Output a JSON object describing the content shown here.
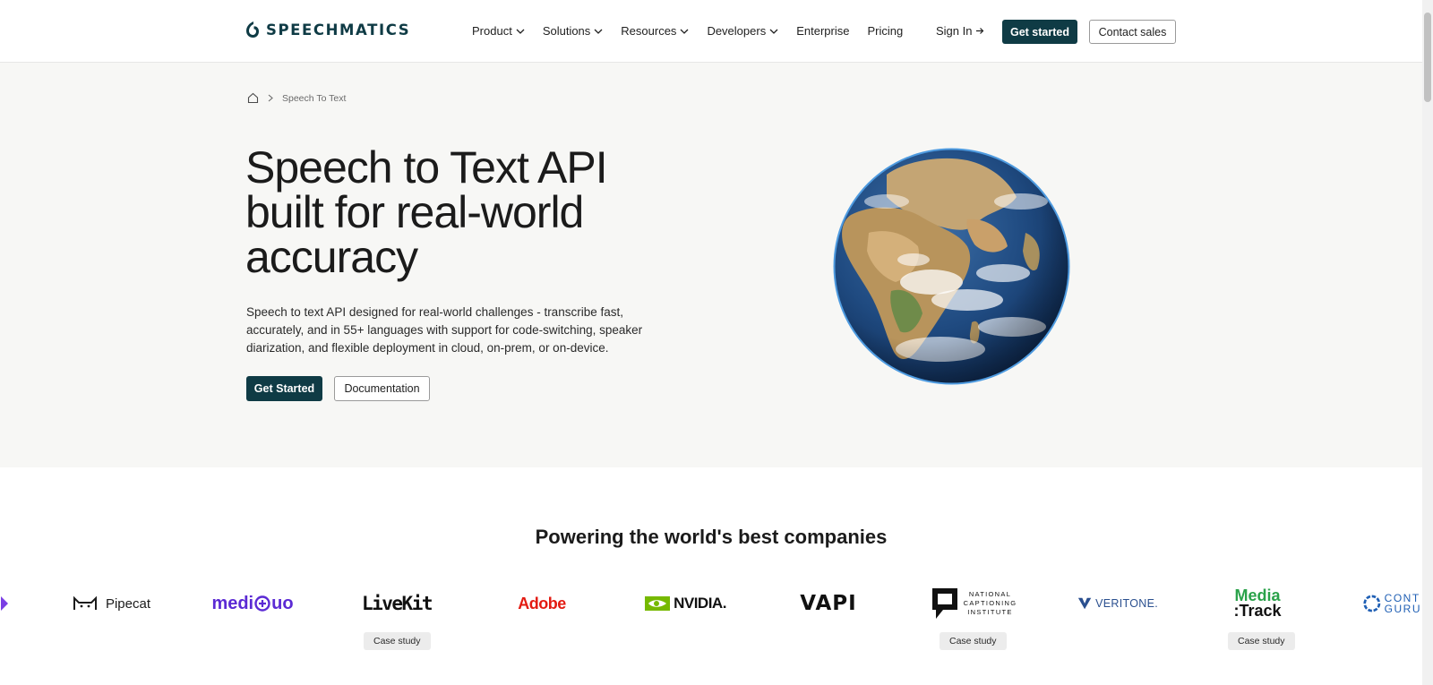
{
  "header": {
    "logo_text": "SPEECHMATICS",
    "nav": [
      "Product",
      "Solutions",
      "Resources",
      "Developers",
      "Enterprise",
      "Pricing"
    ],
    "sign_in": "Sign In",
    "get_started": "Get started",
    "contact_sales": "Contact sales"
  },
  "breadcrumb": {
    "home_icon": "home-icon",
    "current": "Speech To Text"
  },
  "hero": {
    "title_line1": "Speech to Text API",
    "title_line2": "built for real-world",
    "title_line3": "accuracy",
    "description": "Speech to text API designed for real-world challenges - transcribe fast, accurately, and in 55+ languages with support for code-switching, speaker diarization, and flexible deployment in cloud, on-prem, or on-device.",
    "primary_cta": "Get Started",
    "secondary_cta": "Documentation"
  },
  "companies": {
    "heading": "Powering the world's best companies",
    "logos": {
      "pipecat": "Pipecat",
      "mediquo_pre": "medi",
      "mediquo_post": "uo",
      "livekit": "LiveKit",
      "adobe": "Adobe",
      "nvidia": "NVIDIA.",
      "vapi": "VAPI",
      "nci_1": "NATIONAL",
      "nci_2": "CAPTIONING",
      "nci_3": "INSTITUTE",
      "veritone": "VERITONE.",
      "mediatrack_1": "Media",
      "mediatrack_2": ":Track",
      "contentguru_1": "CONT",
      "contentguru_2": "GURU"
    },
    "case_study": "Case study"
  },
  "colors": {
    "brand_dark": "#0f3b45",
    "hero_bg": "#f7f7f5",
    "mediquo": "#5b2ad4",
    "adobe": "#e31b12",
    "nvidia": "#76b900",
    "veritone": "#2a4f8f",
    "mediatrack": "#2aa24a",
    "contentguru": "#1f5fb4"
  }
}
